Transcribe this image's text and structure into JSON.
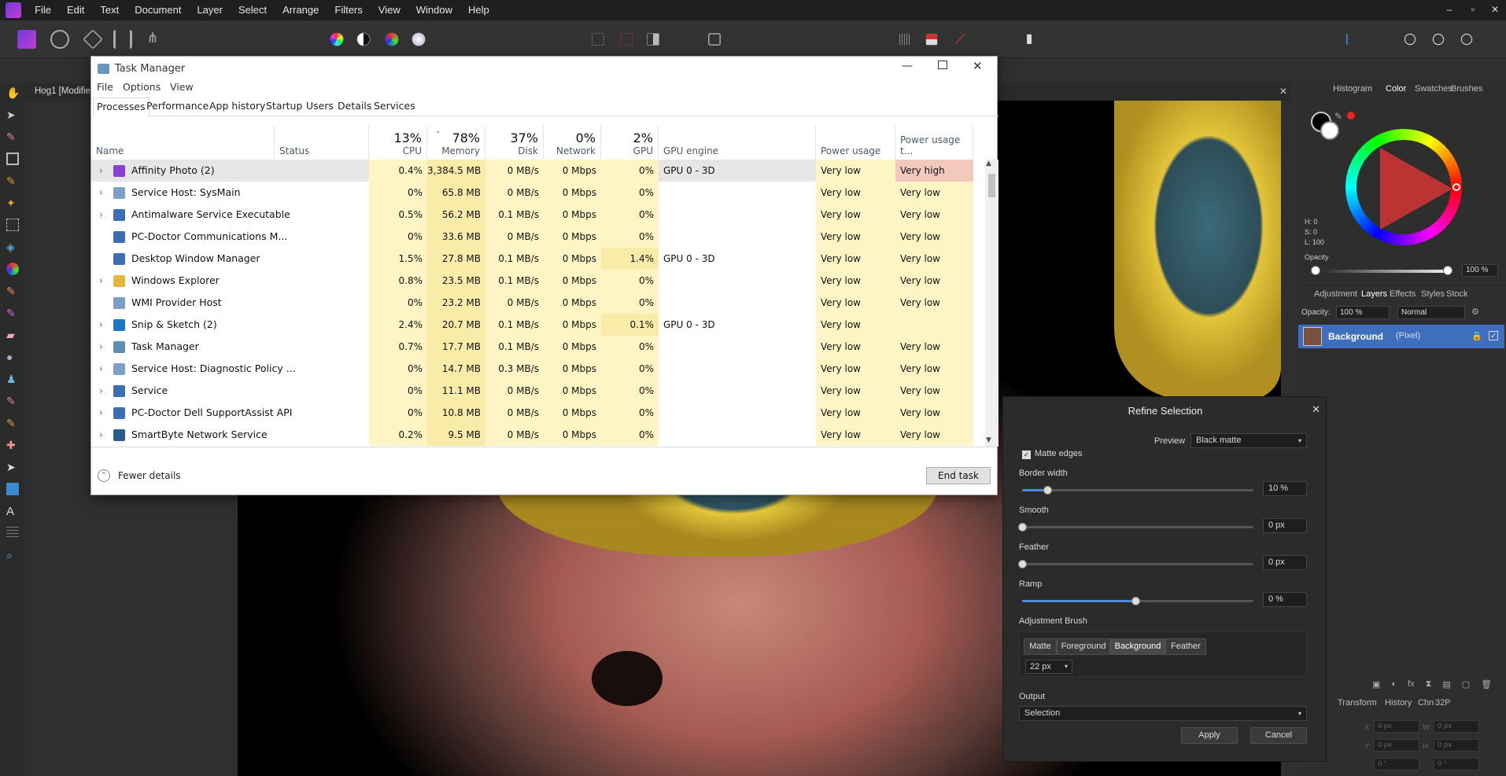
{
  "app": {
    "menu": [
      "File",
      "Edit",
      "Text",
      "Document",
      "Layer",
      "Select",
      "Arrange",
      "Filters",
      "View",
      "Window",
      "Help"
    ],
    "window_controls": [
      "–",
      "▫",
      "✕"
    ],
    "doc_tab": "Hog1 [Modifie"
  },
  "toolbar_icons": [
    "persona-photo-icon",
    "persona-liquify-icon",
    "persona-develop-icon",
    "persona-tone-map-icon",
    "persona-export-icon",
    "color-wheel-icon",
    "contrast-icon",
    "hsl-icon",
    "white-balance-icon",
    "marquee-icon",
    "no-selection-icon",
    "invert-selection-icon",
    "quick-mask-icon",
    "grid-icon",
    "flag-icon",
    "erase-icon",
    "assistant-icon"
  ],
  "task_manager": {
    "title": "Task Manager",
    "menu": [
      "File",
      "Options",
      "View"
    ],
    "tabs": [
      "Processes",
      "Performance",
      "App history",
      "Startup",
      "Users",
      "Details",
      "Services"
    ],
    "active_tab": "Processes",
    "columns": {
      "name": "Name",
      "status": "Status",
      "cpu": {
        "pct": "13%",
        "label": "CPU"
      },
      "memory": {
        "pct": "78%",
        "label": "Memory"
      },
      "disk": {
        "pct": "37%",
        "label": "Disk"
      },
      "network": {
        "pct": "0%",
        "label": "Network"
      },
      "gpu": {
        "pct": "2%",
        "label": "GPU"
      },
      "gpu_engine": "GPU engine",
      "power": "Power usage",
      "power_trend": "Power usage t..."
    },
    "processes": [
      {
        "name": "Affinity Photo (2)",
        "cpu": "0.4%",
        "mem": "3,384.5 MB",
        "disk": "0 MB/s",
        "net": "0 Mbps",
        "gpu": "0%",
        "engine": "GPU 0 - 3D",
        "power": "Very low",
        "trend": "Very high",
        "expand": true,
        "icon": "affinity-icon",
        "color": "#8a3fd6"
      },
      {
        "name": "Service Host: SysMain",
        "cpu": "0%",
        "mem": "65.8 MB",
        "disk": "0 MB/s",
        "net": "0 Mbps",
        "gpu": "0%",
        "engine": "",
        "power": "Very low",
        "trend": "Very low",
        "expand": true,
        "icon": "gear-icon",
        "color": "#7aa0c8"
      },
      {
        "name": "Antimalware Service Executable",
        "cpu": "0.5%",
        "mem": "56.2 MB",
        "disk": "0.1 MB/s",
        "net": "0 Mbps",
        "gpu": "0%",
        "engine": "",
        "power": "Very low",
        "trend": "Very low",
        "expand": true,
        "icon": "app-window-icon",
        "color": "#3a6fb5"
      },
      {
        "name": "PC-Doctor Communications M...",
        "cpu": "0%",
        "mem": "33.6 MB",
        "disk": "0 MB/s",
        "net": "0 Mbps",
        "gpu": "0%",
        "engine": "",
        "power": "Very low",
        "trend": "Very low",
        "expand": false,
        "icon": "app-window-icon",
        "color": "#3a6fb5"
      },
      {
        "name": "Desktop Window Manager",
        "cpu": "1.5%",
        "mem": "27.8 MB",
        "disk": "0.1 MB/s",
        "net": "0 Mbps",
        "gpu": "1.4%",
        "engine": "GPU 0 - 3D",
        "power": "Very low",
        "trend": "Very low",
        "expand": false,
        "icon": "app-window-icon",
        "color": "#3a6fb5"
      },
      {
        "name": "Windows Explorer",
        "cpu": "0.8%",
        "mem": "23.5 MB",
        "disk": "0.1 MB/s",
        "net": "0 Mbps",
        "gpu": "0%",
        "engine": "",
        "power": "Very low",
        "trend": "Very low",
        "expand": true,
        "icon": "folder-icon",
        "color": "#e5b63b"
      },
      {
        "name": "WMI Provider Host",
        "cpu": "0%",
        "mem": "23.2 MB",
        "disk": "0 MB/s",
        "net": "0 Mbps",
        "gpu": "0%",
        "engine": "",
        "power": "Very low",
        "trend": "Very low",
        "expand": false,
        "icon": "gear-icon",
        "color": "#7aa0c8"
      },
      {
        "name": "Snip & Sketch (2)",
        "cpu": "2.4%",
        "mem": "20.7 MB",
        "disk": "0.1 MB/s",
        "net": "0 Mbps",
        "gpu": "0.1%",
        "engine": "GPU 0 - 3D",
        "power": "Very low",
        "trend": "",
        "expand": true,
        "icon": "snip-icon",
        "color": "#1f76c9"
      },
      {
        "name": "Task Manager",
        "cpu": "0.7%",
        "mem": "17.7 MB",
        "disk": "0.1 MB/s",
        "net": "0 Mbps",
        "gpu": "0%",
        "engine": "",
        "power": "Very low",
        "trend": "Very low",
        "expand": true,
        "icon": "task-manager-icon",
        "color": "#5c8fb8"
      },
      {
        "name": "Service Host: Diagnostic Policy ...",
        "cpu": "0%",
        "mem": "14.7 MB",
        "disk": "0.3 MB/s",
        "net": "0 Mbps",
        "gpu": "0%",
        "engine": "",
        "power": "Very low",
        "trend": "Very low",
        "expand": true,
        "icon": "gear-icon",
        "color": "#7aa0c8"
      },
      {
        "name": "Service",
        "cpu": "0%",
        "mem": "11.1 MB",
        "disk": "0 MB/s",
        "net": "0 Mbps",
        "gpu": "0%",
        "engine": "",
        "power": "Very low",
        "trend": "Very low",
        "expand": true,
        "icon": "app-window-icon",
        "color": "#3a6fb5"
      },
      {
        "name": "PC-Doctor Dell SupportAssist API",
        "cpu": "0%",
        "mem": "10.8 MB",
        "disk": "0 MB/s",
        "net": "0 Mbps",
        "gpu": "0%",
        "engine": "",
        "power": "Very low",
        "trend": "Very low",
        "expand": true,
        "icon": "app-window-icon",
        "color": "#3a6fb5"
      },
      {
        "name": "SmartByte Network Service",
        "cpu": "0.2%",
        "mem": "9.5 MB",
        "disk": "0 MB/s",
        "net": "0 Mbps",
        "gpu": "0%",
        "engine": "",
        "power": "Very low",
        "trend": "Very low",
        "expand": true,
        "icon": "smartbyte-icon",
        "color": "#2a5d8f"
      }
    ],
    "fewer_details": "Fewer details",
    "end_task": "End task"
  },
  "right_panel": {
    "top_tabs": [
      "Histogram",
      "Color",
      "Swatches",
      "Brushes"
    ],
    "hsl": {
      "h": "H: 0",
      "s": "S: 0",
      "l": "L: 100"
    },
    "opacity_label": "Opacity",
    "opacity_value": "100 %",
    "layer_tabs": [
      "Adjustment",
      "Layers",
      "Effects",
      "Styles",
      "Stock"
    ],
    "layer_opacity_label": "Opacity:",
    "layer_opacity": "100 %",
    "blend_mode": "Normal",
    "layer_name": "Background",
    "layer_type": "(Pixel)",
    "bottom_tabs": [
      "Transform",
      "History",
      "Chn",
      "32P"
    ],
    "transform": {
      "x": "0 px",
      "y": "0 px",
      "w": "0 px",
      "h": "0 px",
      "r": "0 °",
      "s": "0 °"
    }
  },
  "refine": {
    "title": "Refine Selection",
    "preview_label": "Preview",
    "preview_value": "Black matte",
    "matte_edges": "Matte edges",
    "matte_edges_checked": true,
    "border_width_label": "Border width",
    "border_width": "10 %",
    "smooth_label": "Smooth",
    "smooth": "0 px",
    "feather_label": "Feather",
    "feather": "0 px",
    "ramp_label": "Ramp",
    "ramp": "0 %",
    "brush_label": "Adjustment Brush",
    "brush_modes": [
      "Matte",
      "Foreground",
      "Background",
      "Feather"
    ],
    "brush_active": "Background",
    "brush_size": "22 px",
    "output_label": "Output",
    "output_value": "Selection",
    "apply": "Apply",
    "cancel": "Cancel",
    "slider_levels": {
      "border_width": 0.11,
      "smooth": 0.0,
      "feather": 0.0,
      "ramp": 0.49
    }
  }
}
